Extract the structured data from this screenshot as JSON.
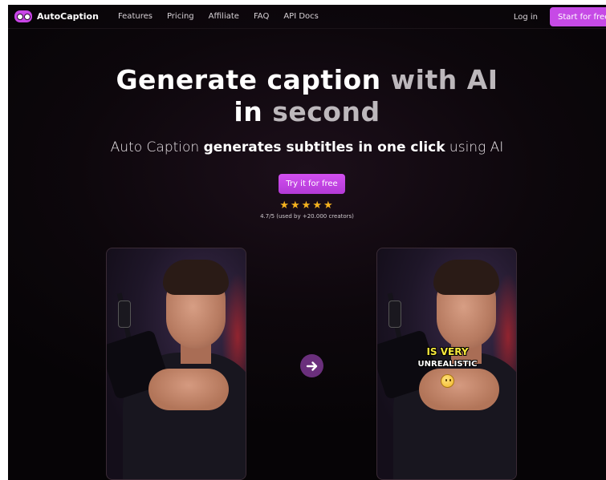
{
  "nav": {
    "brand": "AutoCaption",
    "links": [
      "Features",
      "Pricing",
      "Affiliate",
      "FAQ",
      "API Docs"
    ],
    "login": "Log in",
    "cta": "Start for free"
  },
  "hero": {
    "headline_white": "Generate caption ",
    "headline_dim_1": "with AI",
    "headline_line2_white": "in ",
    "headline_dim_2": "second",
    "subtitle_pre": "Auto Caption ",
    "subtitle_bold": "generates subtitles in one click",
    "subtitle_post": " using AI",
    "button": "Try it for free",
    "stars": "★★★★★",
    "rating": "4.7/5 (used by +20.000 creators)"
  },
  "demo": {
    "caption_line1": "IS VERY",
    "caption_line2": "UNREALISTIC"
  },
  "colors": {
    "accent": "#c64ae6",
    "star": "#f5b21f",
    "caption_yellow": "#f5e83c",
    "background": "#0d070c"
  },
  "icons": {
    "logo": "autocaption-logo-icon",
    "arrow": "arrow-right-icon",
    "emoji": "smiling-emoji-icon"
  }
}
